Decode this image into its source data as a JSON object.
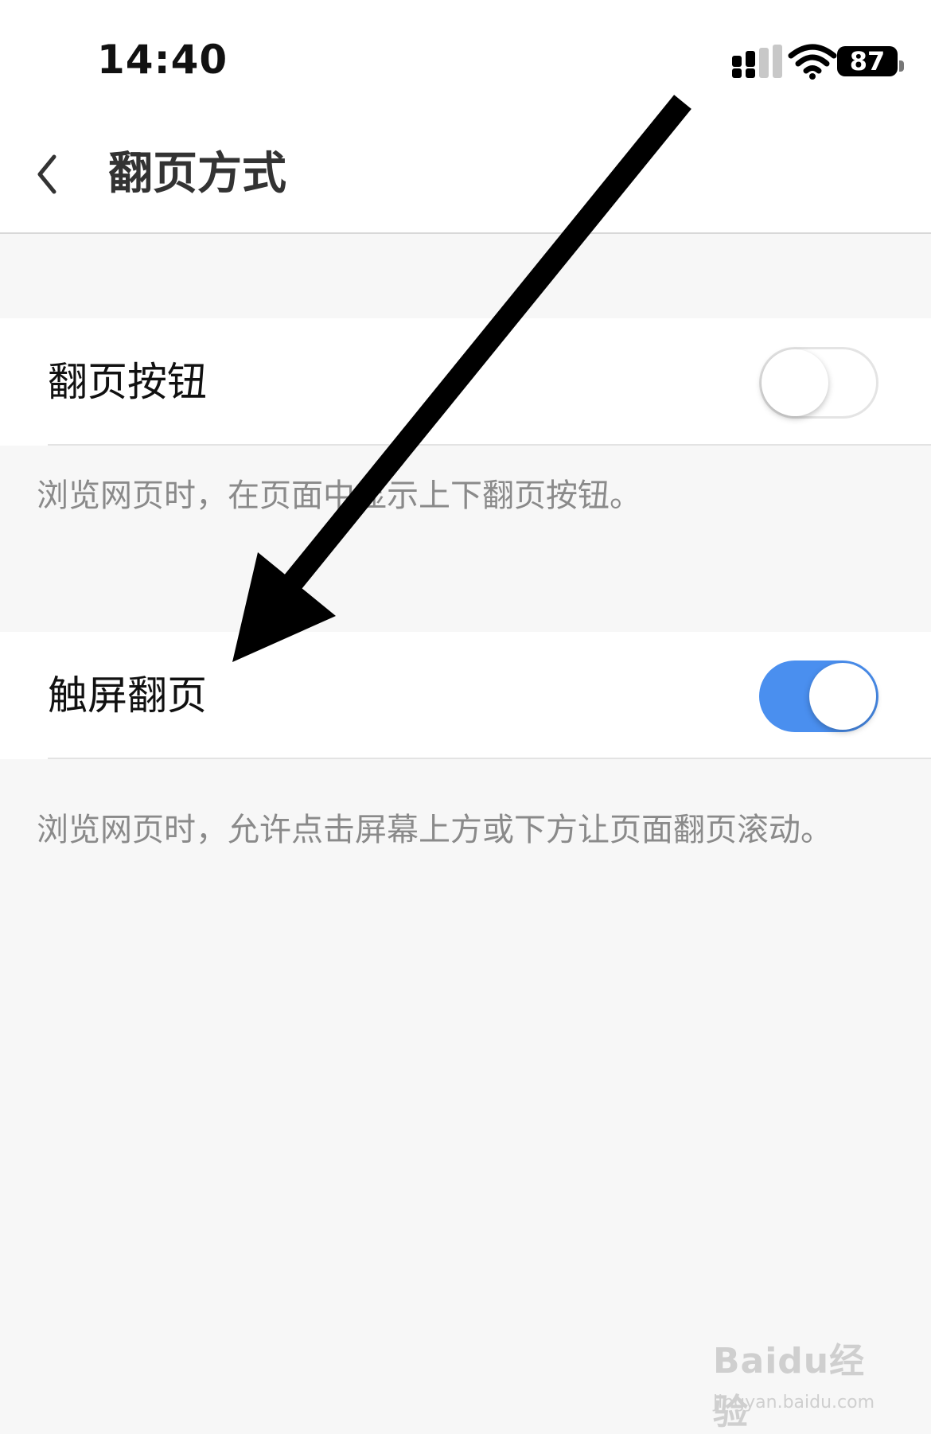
{
  "status_bar": {
    "time": "14:40",
    "battery": "87",
    "icons": [
      "signal-icon",
      "wifi-icon",
      "battery-icon"
    ]
  },
  "nav": {
    "back_icon": "chevron-left-icon",
    "title": "翻页方式"
  },
  "settings": [
    {
      "label": "翻页按钮",
      "enabled": false,
      "description": "浏览网页时，在页面中显示上下翻页按钮。"
    },
    {
      "label": "触屏翻页",
      "enabled": true,
      "description": "浏览网页时，允许点击屏幕上方或下方让页面翻页滚动。"
    }
  ],
  "colors": {
    "accent": "#4a8fef",
    "background": "#f7f7f7",
    "annotation_arrow": "#000000"
  },
  "watermark": {
    "logo": "Baidu经验",
    "url": "jingyan.baidu.com"
  }
}
